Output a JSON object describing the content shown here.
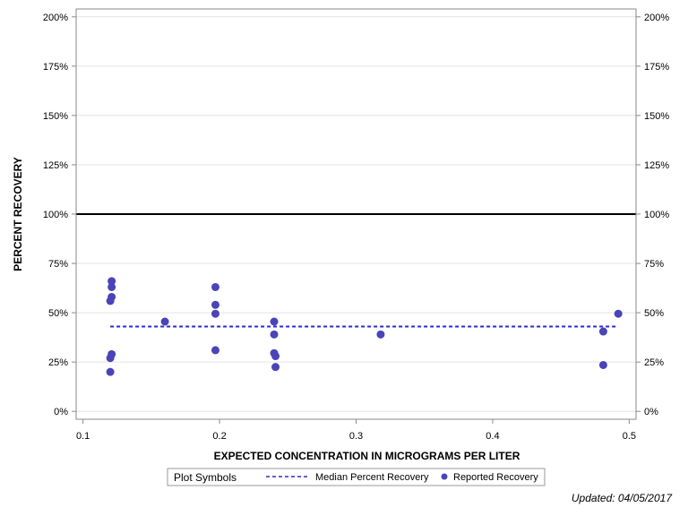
{
  "chart_data": {
    "type": "scatter",
    "xlabel": "EXPECTED CONCENTRATION IN MICROGRAMS PER LITER",
    "ylabel": "PERCENT RECOVERY",
    "xlim": [
      0.095,
      0.505
    ],
    "ylim": [
      -4,
      204
    ],
    "x_ticks": [
      0.1,
      0.2,
      0.3,
      0.4,
      0.5
    ],
    "x_tick_labels": [
      "0.1",
      "0.2",
      "0.3",
      "0.4",
      "0.5"
    ],
    "y_ticks": [
      0,
      25,
      50,
      75,
      100,
      125,
      150,
      175,
      200
    ],
    "y_tick_labels": [
      "0%",
      "25%",
      "50%",
      "75%",
      "100%",
      "125%",
      "150%",
      "175%",
      "200%"
    ],
    "y_right_tick_labels": [
      "0%",
      "25%",
      "50%",
      "75%",
      "100%",
      "125%",
      "150%",
      "175%",
      "200%"
    ],
    "grid": true,
    "reference_line": {
      "y": 100,
      "color": "#000000"
    },
    "series": [
      {
        "name": "Reported Recovery",
        "color": "#4a44b8",
        "marker": "circle",
        "points": [
          {
            "x": 0.121,
            "y": 66
          },
          {
            "x": 0.121,
            "y": 63
          },
          {
            "x": 0.121,
            "y": 58
          },
          {
            "x": 0.12,
            "y": 56
          },
          {
            "x": 0.121,
            "y": 29
          },
          {
            "x": 0.12,
            "y": 27
          },
          {
            "x": 0.12,
            "y": 20
          },
          {
            "x": 0.16,
            "y": 45.5
          },
          {
            "x": 0.197,
            "y": 63
          },
          {
            "x": 0.197,
            "y": 54
          },
          {
            "x": 0.197,
            "y": 49.5
          },
          {
            "x": 0.197,
            "y": 31
          },
          {
            "x": 0.24,
            "y": 45.5
          },
          {
            "x": 0.24,
            "y": 39
          },
          {
            "x": 0.24,
            "y": 29.5
          },
          {
            "x": 0.241,
            "y": 28
          },
          {
            "x": 0.241,
            "y": 22.5
          },
          {
            "x": 0.318,
            "y": 39
          },
          {
            "x": 0.481,
            "y": 40.5
          },
          {
            "x": 0.481,
            "y": 23.5
          },
          {
            "x": 0.492,
            "y": 49.5
          }
        ]
      },
      {
        "name": "Median Percent Recovery",
        "color": "#2a2ad0",
        "style": "dashed",
        "x": [
          0.12,
          0.492
        ],
        "y": [
          43,
          43
        ]
      }
    ],
    "legend": {
      "title": "Plot Symbols",
      "placement": "bottom-center",
      "entries": [
        {
          "label": "Median Percent Recovery",
          "symbol": "dashed-line"
        },
        {
          "label": "Reported Recovery",
          "symbol": "dot"
        }
      ]
    }
  },
  "footer": {
    "updated": "Updated: 04/05/2017"
  },
  "colors": {
    "grid": "#e4e4e4",
    "axis": "#8a8a8a",
    "reference": "#000000",
    "points": "#4a44b8",
    "median": "#2a2ad0"
  }
}
